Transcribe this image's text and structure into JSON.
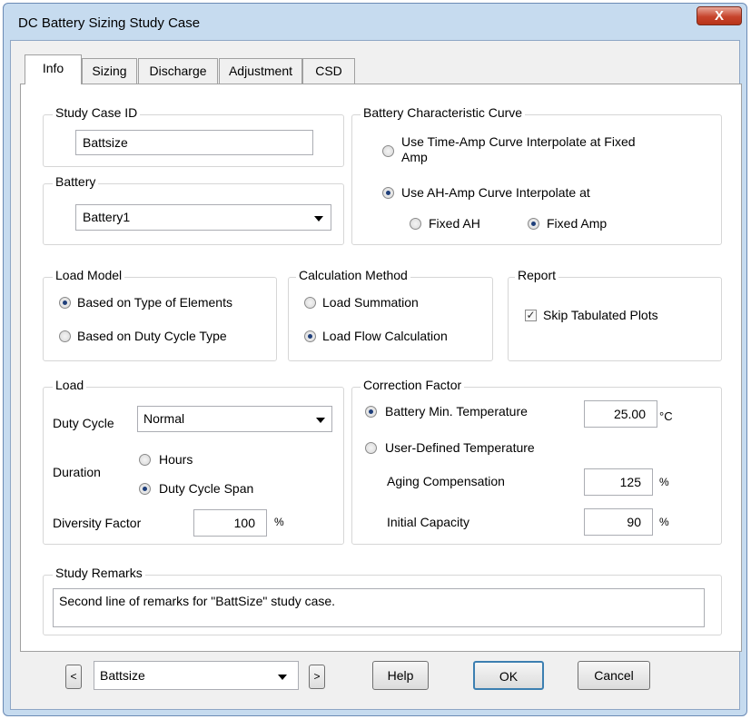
{
  "window": {
    "title": "DC Battery Sizing Study Case",
    "close_label": "X"
  },
  "tabs": [
    "Info",
    "Sizing",
    "Discharge",
    "Adjustment",
    "CSD"
  ],
  "study_case_id": {
    "legend": "Study Case ID",
    "value": "Battsize"
  },
  "battery": {
    "legend": "Battery",
    "selected": "Battery1"
  },
  "characteristic_curve": {
    "legend": "Battery Characteristic Curve",
    "option_time_amp_line1": "Use Time-Amp Curve Interpolate at Fixed",
    "option_time_amp_line2": "Amp",
    "option_ah_amp": "Use AH-Amp Curve Interpolate at",
    "fixed_ah": "Fixed AH",
    "fixed_amp": "Fixed Amp"
  },
  "load_model": {
    "legend": "Load Model",
    "option_elements": "Based on Type of Elements",
    "option_duty": "Based on Duty Cycle Type"
  },
  "calc_method": {
    "legend": "Calculation Method",
    "option_summation": "Load Summation",
    "option_flow": "Load Flow Calculation"
  },
  "report": {
    "legend": "Report",
    "skip_tabulated": "Skip Tabulated Plots"
  },
  "load": {
    "legend": "Load",
    "duty_cycle_label": "Duty Cycle",
    "duty_cycle_value": "Normal",
    "duration_label": "Duration",
    "hours": "Hours",
    "duty_cycle_span": "Duty Cycle Span",
    "diversity_label": "Diversity Factor",
    "diversity_value": "100",
    "diversity_unit": "%"
  },
  "correction": {
    "legend": "Correction Factor",
    "battery_min_temp": "Battery Min. Temperature",
    "temp_value": "25.00",
    "temp_unit": "°C",
    "user_defined_temp": "User-Defined Temperature",
    "aging_label": "Aging Compensation",
    "aging_value": "125",
    "aging_unit": "%",
    "initial_label": "Initial Capacity",
    "initial_value": "90",
    "initial_unit": "%"
  },
  "remarks": {
    "legend": "Study Remarks",
    "text": "Second line of remarks for \"BattSize\" study case."
  },
  "footer": {
    "prev": "<",
    "next": ">",
    "selected": "Battsize",
    "help": "Help",
    "ok": "OK",
    "cancel": "Cancel"
  }
}
